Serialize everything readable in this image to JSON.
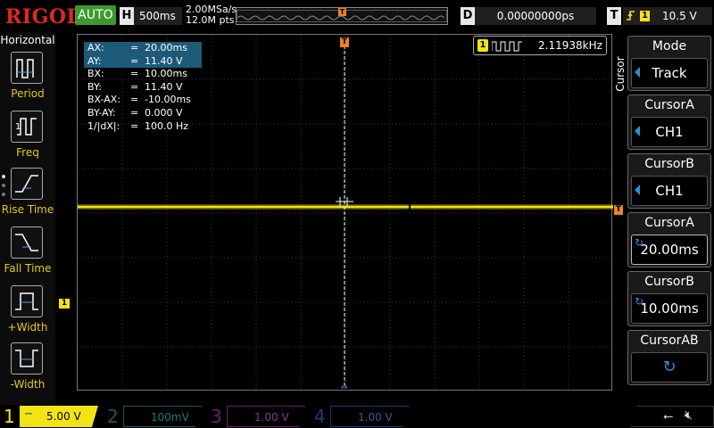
{
  "brand": {
    "logo": "RIGOL",
    "run_mode": "AUTO"
  },
  "timebase": {
    "key": "H",
    "scale": "500ms",
    "sample_rate": "2.00MSa/s",
    "memory_depth": "12.0M pts"
  },
  "delay": {
    "key": "D",
    "value": "0.00000000ps"
  },
  "trigger": {
    "key": "T",
    "source": "1",
    "level": "10.5 V",
    "marker": "T"
  },
  "left_menu": {
    "title": "Horizontal",
    "items": [
      {
        "label": "Period",
        "icon": "period-icon"
      },
      {
        "label": "Freq",
        "icon": "freq-icon"
      },
      {
        "label": "Rise Time",
        "icon": "rise-time-icon"
      },
      {
        "label": "Fall Time",
        "icon": "fall-time-icon"
      },
      {
        "label": "+Width",
        "icon": "pos-width-icon"
      },
      {
        "label": "-Width",
        "icon": "neg-width-icon"
      }
    ]
  },
  "cursor_readout": [
    {
      "key": "AX:",
      "eq": "=",
      "value": "20.00ms"
    },
    {
      "key": "AY:",
      "eq": "=",
      "value": "11.40 V"
    },
    {
      "key": "BX:",
      "eq": "=",
      "value": "10.00ms"
    },
    {
      "key": "BY:",
      "eq": "=",
      "value": "11.40 V"
    },
    {
      "key": "BX-AX:",
      "eq": "=",
      "value": "-10.00ms"
    },
    {
      "key": "BY-AY:",
      "eq": "=",
      "value": "0.000 V"
    },
    {
      "key": "1/|dX|:",
      "eq": "=",
      "value": "100.0 Hz"
    }
  ],
  "freq_counter": {
    "channel": "1",
    "value": "2.11938kHz"
  },
  "channel1_marker": "1",
  "right_menu": {
    "tab_label": "Cursor",
    "items": [
      {
        "header": "Mode",
        "value": "Track"
      },
      {
        "header": "CursorA",
        "value": "CH1"
      },
      {
        "header": "CursorB",
        "value": "CH1"
      },
      {
        "header": "CursorA",
        "value": "20.00ms"
      },
      {
        "header": "CursorB",
        "value": "10.00ms"
      },
      {
        "header": "CursorAB",
        "value": ""
      }
    ]
  },
  "channels": [
    {
      "num": "1",
      "scale": "5.00 V",
      "color": "#f2e414",
      "active": true
    },
    {
      "num": "2",
      "scale": "100mV",
      "color": "#1ec8c8",
      "active": false
    },
    {
      "num": "3",
      "scale": "1.00 V",
      "color": "#d23cd2",
      "active": false
    },
    {
      "num": "4",
      "scale": "1.00 V",
      "color": "#2e6ed6",
      "active": false
    }
  ],
  "status_icons": [
    "usb-icon",
    "speaker-muted-icon"
  ],
  "colors": {
    "trace": "#f2e414",
    "trigger": "#f08020",
    "accent": "#2e8fd6",
    "logo": "#e0281c",
    "auto": "#3c9a2c"
  }
}
